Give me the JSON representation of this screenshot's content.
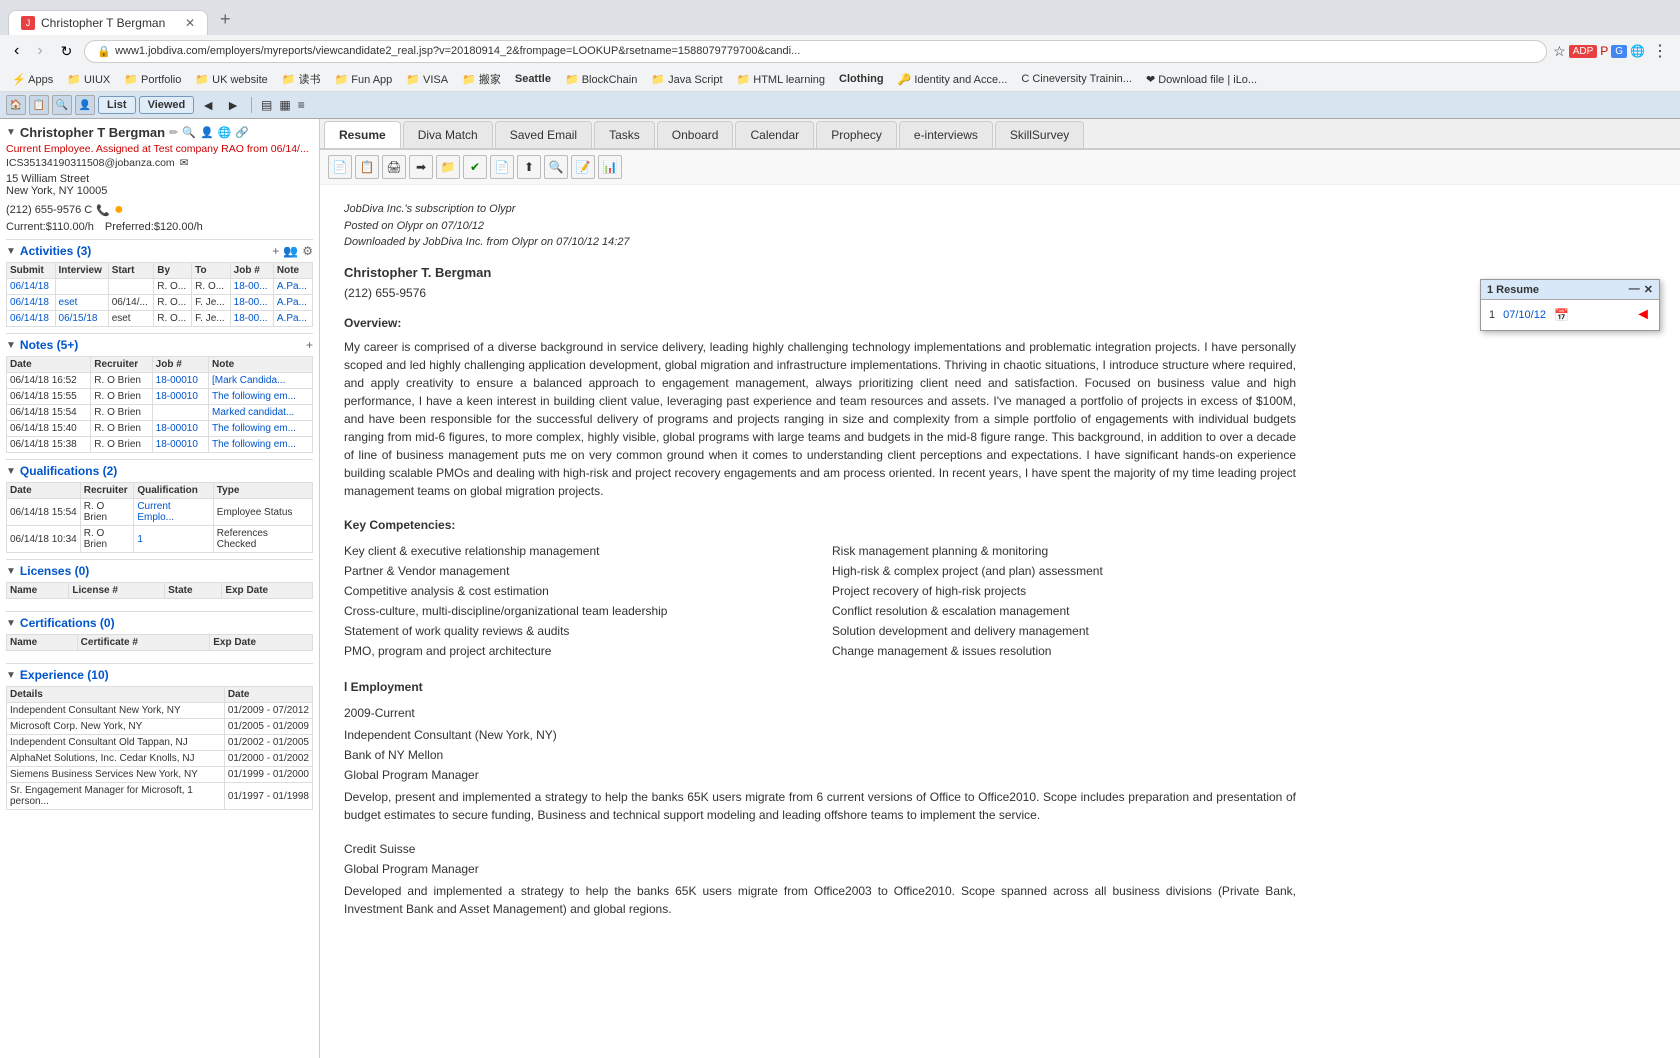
{
  "browser": {
    "tab_title": "Christopher T Bergman",
    "url": "www1.jobdiva.com/employers/myreports/viewcandidate2_real.jsp?v=20180914_2&frompage=LOOKUP&rsetname=1588079779700&candi...",
    "bookmarks": [
      "Apps",
      "UIUX",
      "Portfolio",
      "UK website",
      "读书",
      "Fun App",
      "VISA",
      "搬家",
      "Seattle",
      "BlockChain",
      "Java Script",
      "HTML learning",
      "Clothing",
      "Identity and Acce...",
      "Cineversity Trainin...",
      "Download file | iLo..."
    ]
  },
  "left_panel": {
    "candidate_name": "Christopher T Bergman",
    "status": "Current Employee. Assigned at Test company RAO from 06/14/...",
    "ics": "ICS35134190311508@jobanza.com",
    "address_line1": "15 William Street",
    "address_line2": "New York, NY 10005",
    "phone": "(212) 655-9576 C",
    "current_rate": "Current:$110.00/h",
    "preferred_rate": "Preferred:$120.00/h",
    "activities_section": {
      "label": "Activities (3)",
      "headers": [
        "Submit",
        "Interview",
        "Start",
        "By",
        "To",
        "Job #",
        "Note"
      ],
      "rows": [
        {
          "submit": "06/14/18",
          "interview": "",
          "start": "",
          "by": "R. O...",
          "to": "R. O...",
          "job": "18-00...",
          "note": "A.Pa..."
        },
        {
          "submit": "06/14/18",
          "interview": "eset",
          "start": "06/14/...",
          "by": "R. O...",
          "to": "F. Je...",
          "job": "18-00...",
          "note": "A.Pa..."
        },
        {
          "submit": "06/14/18",
          "interview": "06/15/18",
          "start": "eset",
          "by": "R. O...",
          "to": "F. Je...",
          "job": "18-00...",
          "note": "A.Pa..."
        }
      ]
    },
    "notes_section": {
      "label": "Notes (5+)",
      "headers": [
        "Date",
        "Recruiter",
        "Job #",
        "Note"
      ],
      "rows": [
        {
          "date": "06/14/18 16:52",
          "recruiter": "R. O Brien",
          "job": "18-00010",
          "note": "[Mark Candida..."
        },
        {
          "date": "06/14/18 15:55",
          "recruiter": "R. O Brien",
          "job": "18-00010",
          "note": "The following em..."
        },
        {
          "date": "06/14/18 15:54",
          "recruiter": "R. O Brien",
          "job": "",
          "note": "Marked candidat..."
        },
        {
          "date": "06/14/18 15:40",
          "recruiter": "R. O Brien",
          "job": "18-00010",
          "note": "The following em..."
        },
        {
          "date": "06/14/18 15:38",
          "recruiter": "R. O Brien",
          "job": "18-00010",
          "note": "The following em..."
        }
      ]
    },
    "qualifications_section": {
      "label": "Qualifications (2)",
      "headers": [
        "Date",
        "Recruiter",
        "Qualification",
        "Type"
      ],
      "rows": [
        {
          "date": "06/14/18 15:54",
          "recruiter": "R. O Brien",
          "qual": "Current Emplo...",
          "type": "Employee Status"
        },
        {
          "date": "06/14/18 10:34",
          "recruiter": "R. O Brien",
          "qual": "1",
          "type": "References Checked"
        }
      ]
    },
    "licenses_section": {
      "label": "Licenses (0)",
      "headers": [
        "Name",
        "License #",
        "State",
        "Exp Date"
      ]
    },
    "certifications_section": {
      "label": "Certifications (0)",
      "headers": [
        "Name",
        "Certificate #",
        "Exp Date"
      ]
    },
    "experience_section": {
      "label": "Experience (10)",
      "headers": [
        "Details",
        "Date"
      ],
      "rows": [
        {
          "details": "Independent Consultant New York, NY",
          "date": "01/2009 - 07/2012"
        },
        {
          "details": "Microsoft Corp. New York, NY",
          "date": "01/2005 - 01/2009"
        },
        {
          "details": "Independent Consultant Old Tappan, NJ",
          "date": "01/2002 - 01/2005"
        },
        {
          "details": "AlphaNet Solutions, Inc. Cedar Knolls, NJ",
          "date": "01/2000 - 01/2002"
        },
        {
          "details": "Siemens Business Services New York, NY",
          "date": "01/1999 - 01/2000"
        },
        {
          "details": "Sr. Engagement Manager for Microsoft, 1 person...",
          "date": "01/1997 - 01/1998"
        }
      ]
    }
  },
  "tabs": {
    "items": [
      "Resume",
      "Diva Match",
      "Saved Email",
      "Tasks",
      "Onboard",
      "Calendar",
      "Prophecy",
      "e-interviews",
      "SkillSurvey"
    ],
    "active": "Resume"
  },
  "resume_float": {
    "header": "1 Resume",
    "row_num": "1",
    "date": "07/10/12"
  },
  "resume": {
    "meta1": "JobDiva Inc.'s subscription to Olypr",
    "meta2": "Posted on Olypr on 07/10/12",
    "meta3": "Downloaded by JobDiva Inc. from Olypr on 07/10/12 14:27",
    "name": "Christopher T. Bergman",
    "phone": "(212) 655-9576",
    "overview_label": "Overview:",
    "overview_text": "My career is comprised of a diverse background in service delivery, leading highly challenging technology implementations and problematic integration projects. I have personally scoped and led highly challenging application development, global migration and infrastructure implementations. Thriving in chaotic situations, I introduce structure where required, and apply creativity to ensure a balanced approach to engagement management, always prioritizing client need and satisfaction. Focused on business value and high performance, I have a keen interest in building client value, leveraging past experience and team resources and assets. I've managed a portfolio of projects in excess of $100M, and have been responsible for the successful delivery of programs and projects ranging in size and complexity from a simple portfolio of engagements with individual budgets ranging from mid-6 figures, to more complex, highly visible, global programs with large teams and budgets in the mid-8 figure range. This background, in addition to over a decade of line of business management puts me on very common ground when it comes to understanding client perceptions and expectations. I have significant hands-on experience building scalable PMOs and dealing with high-risk and project recovery engagements and am process oriented. In recent years, I have spent the majority of my time leading project management teams on global migration projects.",
    "key_competencies_label": "Key Competencies:",
    "competencies": [
      "Key client & executive relationship management",
      "Partner & Vendor management",
      "Competitive analysis & cost estimation",
      "Cross-culture, multi-discipline/organizational team leadership",
      "Statement of work quality reviews & audits",
      "PMO, program and project architecture",
      "",
      "Risk management planning & monitoring",
      "High-risk & complex project (and plan) assessment",
      "Project recovery of high-risk projects",
      "Conflict resolution & escalation management",
      "Solution development and delivery management",
      "Change management & issues resolution"
    ],
    "employment_label": "l Employment",
    "employment_period": "2009-Current",
    "employer1": "Independent Consultant (New York, NY)",
    "employer1_sub": "Bank of NY Mellon",
    "role1": "Global Program Manager",
    "role1_desc": "Develop, present and implemented a strategy to help the banks 65K users migrate from 6 current versions of Office to Office2010. Scope includes preparation and presentation of budget estimates to secure funding, Business and technical support modeling and leading offshore teams to implement the service.",
    "employer2": "Credit Suisse",
    "role2": "Global Program Manager",
    "role2_desc": "Developed and implemented a strategy to help the banks 65K users migrate from Office2003 to Office2010. Scope spanned across all business divisions (Private Bank, Investment Bank and Asset Management) and global regions."
  }
}
